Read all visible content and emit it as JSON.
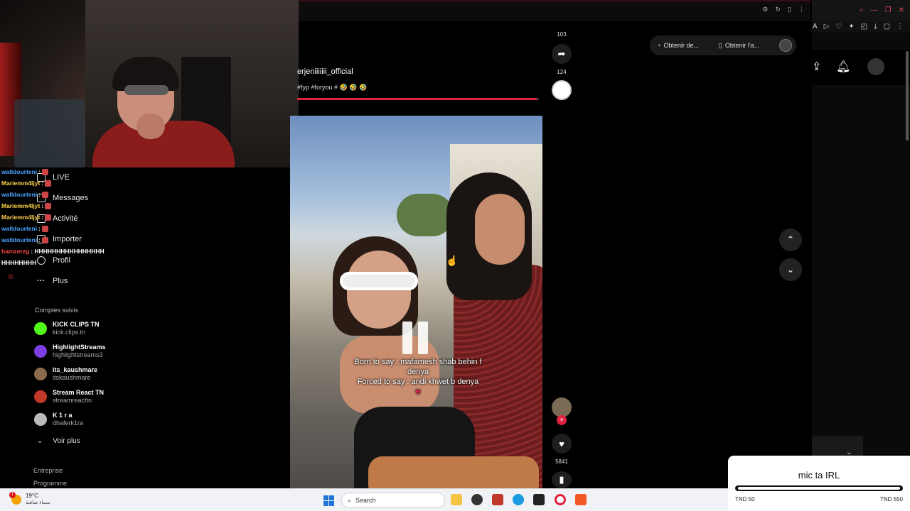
{
  "chat": [
    {
      "user": "walldourteni",
      "color": "#4aa3ff",
      "text": ":"
    },
    {
      "user": "Mariemm4ljyt",
      "color": "#ffd24a",
      "text": ":"
    },
    {
      "user": "walldourteni",
      "color": "#4aa3ff",
      "text": ":"
    },
    {
      "user": "Mariemm4ljyt",
      "color": "#ffd24a",
      "text": ":"
    },
    {
      "user": "Mariemm4ljyt",
      "color": "#ffd24a",
      "text": ":"
    },
    {
      "user": "walldourteni",
      "color": "#4aa3ff",
      "text": ":"
    },
    {
      "user": "walldourteni",
      "color": "#4aa3ff",
      "text": ":"
    },
    {
      "user": "hamzerzg",
      "color": "#ff4a4a",
      "text": ": HHHHHHHHHHHHHHHH"
    },
    {
      "user": "",
      "color": "#ffffff",
      "text": "HHHHHHHH"
    }
  ],
  "nav": {
    "live": "LIVE",
    "messages": "Messages",
    "activity": "Activité",
    "import": "Importer",
    "profile": "Profil",
    "more": "Plus"
  },
  "followed": {
    "title": "Comptes suivis",
    "accounts": [
      {
        "name": "KICK CLIPS TN",
        "handle": "kick.clips.tn",
        "color": "#53fc18"
      },
      {
        "name": "HighlightStreams",
        "handle": "highlightstreams3",
        "color": "#7b3fe4"
      },
      {
        "name": "its_kaushmare",
        "handle": "itskaushmare",
        "color": "#8a6a4a"
      },
      {
        "name": "Stream React TN",
        "handle": "streamreacttn",
        "color": "#c0392b"
      },
      {
        "name": "K 1 r a",
        "handle": "dhaferk1ra",
        "color": "#bbbbbb"
      }
    ],
    "see_more": "Voir plus"
  },
  "footer": {
    "company": "Entreprise",
    "program": "Programme"
  },
  "post": {
    "username": "erjeniiiiiii_official",
    "tags": "#fyp #foryou # 🤣 🤣 🤣",
    "caption_line1": "Born to say : mafamesh shab behin f denya",
    "caption_line2": "Forced to say : andi khwet b denya",
    "progress": 0.99
  },
  "rail": {
    "count_top": "103",
    "count_share": "124",
    "count_likes": "5841"
  },
  "obtenir": {
    "btn1": "Obtenir de...",
    "btn2": "Obtenir l'a..."
  },
  "donation": {
    "title": "mic ta IRL",
    "min": "TND 50",
    "max": "TND 550",
    "progress": 1.0
  },
  "taskbar": {
    "temperature": "19°C",
    "weather_text": "سماء صافية",
    "weather_badge": "1",
    "search_placeholder": "Search"
  },
  "colors": {
    "accent": "#e0213f",
    "kick_green": "#53fc18"
  }
}
